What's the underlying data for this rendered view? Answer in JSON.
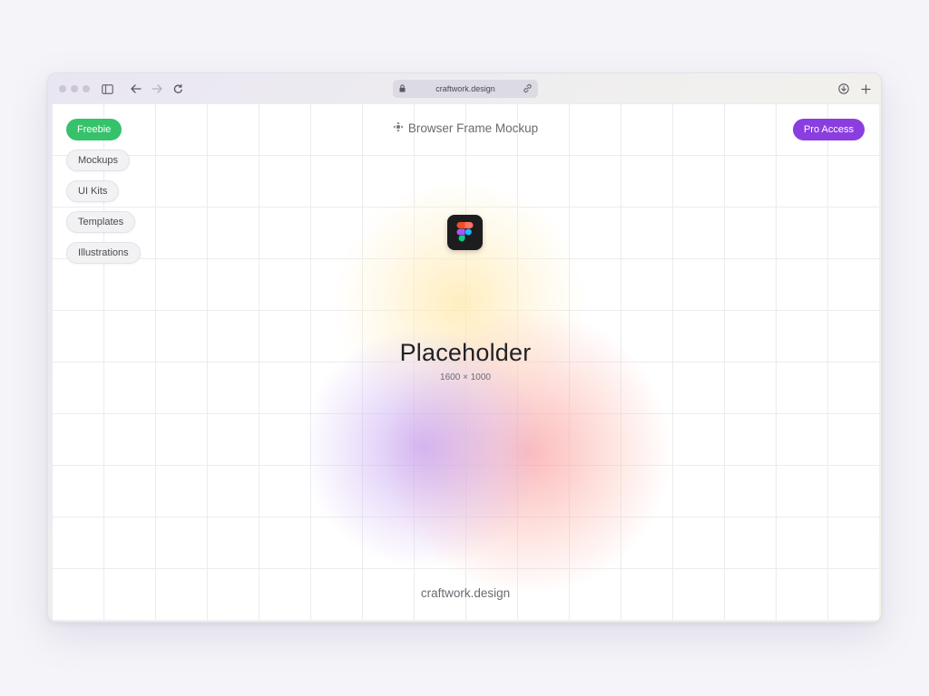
{
  "browser": {
    "address": "craftwork.design",
    "icons": {
      "sidebar": "sidebar-icon",
      "back": "arrow-left-icon",
      "forward": "arrow-right-icon",
      "reload": "reload-icon",
      "lock": "lock-icon",
      "link": "link-icon",
      "download": "download-icon",
      "new_tab": "plus-icon"
    }
  },
  "page": {
    "title_icon": "move-arrows-icon",
    "title": "Browser Frame Mockup",
    "categories": [
      {
        "label": "Freebie",
        "active": true
      },
      {
        "label": "Mockups"
      },
      {
        "label": "UI Kits"
      },
      {
        "label": "Templates"
      },
      {
        "label": "Illustrations"
      }
    ],
    "pro_button": "Pro Access",
    "app_icon": "figma-icon",
    "placeholder_title": "Placeholder",
    "placeholder_size": "1600 × 1000",
    "footer": "craftwork.design"
  },
  "colors": {
    "freebie": "#35c26b",
    "pro": "#8b3ee0",
    "glow_yellow": "#ffe8aa",
    "glow_pink": "#fa9696",
    "glow_purple": "#be96f0"
  }
}
